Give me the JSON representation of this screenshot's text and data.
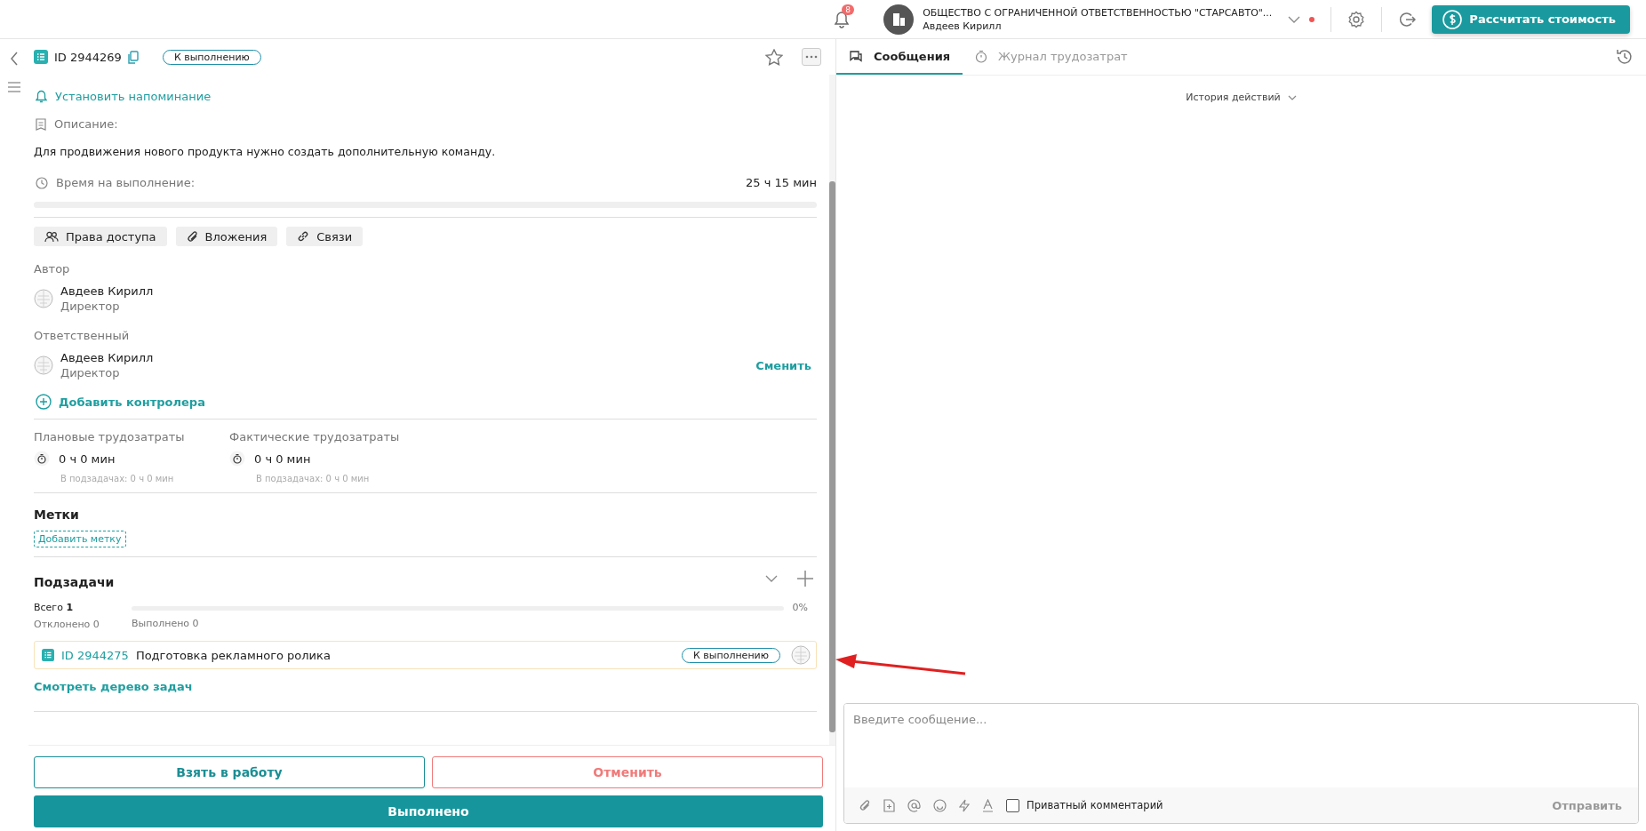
{
  "header": {
    "notifications": {
      "count": "8"
    },
    "company": {
      "name": "ОБЩЕСТВО С ОГРАНИЧЕННОЙ ОТВЕТСТВЕННОСТЬЮ \"СТАРСАВТО\"...",
      "user": "Авдеев Кирилл"
    },
    "cta": "Рассчитать стоимость"
  },
  "task": {
    "id": "ID 2944269",
    "status": "К выполнению",
    "favorite": false,
    "reminder": "Установить напоминание",
    "description_label": "Описание:",
    "description": "Для продвижения нового продукта нужно создать дополнительную команду.",
    "time_label": "Время на выполнение:",
    "time_value": "25 ч 15 мин",
    "sections": [
      {
        "kind": "access",
        "label": "Права доступа"
      },
      {
        "kind": "attachments",
        "label": "Вложения"
      },
      {
        "kind": "links",
        "label": "Связи"
      }
    ],
    "people": [
      {
        "role": "Автор",
        "name": "Авдеев Кирилл",
        "position": "Директор"
      },
      {
        "role": "Ответственный",
        "name": "Авдеев Кирилл",
        "position": "Директор",
        "action": "Сменить"
      }
    ],
    "add_controller": "Добавить контролера",
    "efforts": [
      {
        "label": "Плановые трудозатраты",
        "value": "0 ч 0 мин",
        "sub": "В подзадачах: 0 ч 0 мин"
      },
      {
        "label": "Фактические трудозатраты",
        "value": "0 ч 0 мин",
        "sub": "В подзадачах: 0 ч 0 мин"
      }
    ],
    "tags": {
      "title": "Метки",
      "add": "Добавить метку"
    },
    "subtasks": {
      "title": "Подзадачи",
      "total": "Всего **1**",
      "rejected": "Отклонено 0",
      "done": "Выполнено 0",
      "percent": "0%",
      "items": [
        {
          "id": "ID 2944275",
          "title": "Подготовка рекламного ролика",
          "status": "К выполнению"
        }
      ],
      "tree_link": "Смотреть дерево задач"
    },
    "actions": {
      "take": "Взять в работу",
      "cancel": "Отменить",
      "done": "Выполнено"
    }
  },
  "chat": {
    "tabs": [
      {
        "label": "Сообщения",
        "kind": "messages",
        "selected": true
      },
      {
        "label": "Журнал трудозатрат",
        "kind": "timer",
        "selected": false
      }
    ],
    "history": "История действий",
    "placeholder": "Введите сообщение...",
    "private_label": "Приватный комментарий",
    "private": false,
    "send": "Отправить"
  }
}
